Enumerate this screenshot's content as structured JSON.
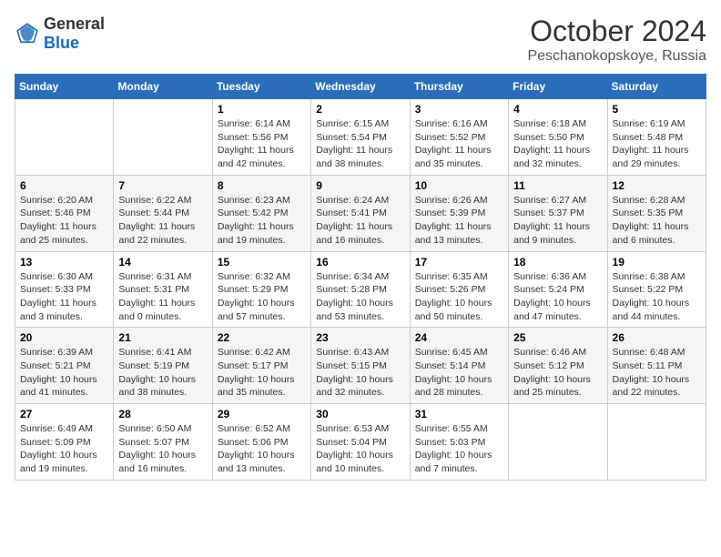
{
  "header": {
    "logo": {
      "text_general": "General",
      "text_blue": "Blue"
    },
    "title": "October 2024",
    "location": "Peschanokopskoye, Russia"
  },
  "weekdays": [
    "Sunday",
    "Monday",
    "Tuesday",
    "Wednesday",
    "Thursday",
    "Friday",
    "Saturday"
  ],
  "weeks": [
    [
      null,
      null,
      {
        "day": "1",
        "sunrise": "Sunrise: 6:14 AM",
        "sunset": "Sunset: 5:56 PM",
        "daylight": "Daylight: 11 hours and 42 minutes."
      },
      {
        "day": "2",
        "sunrise": "Sunrise: 6:15 AM",
        "sunset": "Sunset: 5:54 PM",
        "daylight": "Daylight: 11 hours and 38 minutes."
      },
      {
        "day": "3",
        "sunrise": "Sunrise: 6:16 AM",
        "sunset": "Sunset: 5:52 PM",
        "daylight": "Daylight: 11 hours and 35 minutes."
      },
      {
        "day": "4",
        "sunrise": "Sunrise: 6:18 AM",
        "sunset": "Sunset: 5:50 PM",
        "daylight": "Daylight: 11 hours and 32 minutes."
      },
      {
        "day": "5",
        "sunrise": "Sunrise: 6:19 AM",
        "sunset": "Sunset: 5:48 PM",
        "daylight": "Daylight: 11 hours and 29 minutes."
      }
    ],
    [
      {
        "day": "6",
        "sunrise": "Sunrise: 6:20 AM",
        "sunset": "Sunset: 5:46 PM",
        "daylight": "Daylight: 11 hours and 25 minutes."
      },
      {
        "day": "7",
        "sunrise": "Sunrise: 6:22 AM",
        "sunset": "Sunset: 5:44 PM",
        "daylight": "Daylight: 11 hours and 22 minutes."
      },
      {
        "day": "8",
        "sunrise": "Sunrise: 6:23 AM",
        "sunset": "Sunset: 5:42 PM",
        "daylight": "Daylight: 11 hours and 19 minutes."
      },
      {
        "day": "9",
        "sunrise": "Sunrise: 6:24 AM",
        "sunset": "Sunset: 5:41 PM",
        "daylight": "Daylight: 11 hours and 16 minutes."
      },
      {
        "day": "10",
        "sunrise": "Sunrise: 6:26 AM",
        "sunset": "Sunset: 5:39 PM",
        "daylight": "Daylight: 11 hours and 13 minutes."
      },
      {
        "day": "11",
        "sunrise": "Sunrise: 6:27 AM",
        "sunset": "Sunset: 5:37 PM",
        "daylight": "Daylight: 11 hours and 9 minutes."
      },
      {
        "day": "12",
        "sunrise": "Sunrise: 6:28 AM",
        "sunset": "Sunset: 5:35 PM",
        "daylight": "Daylight: 11 hours and 6 minutes."
      }
    ],
    [
      {
        "day": "13",
        "sunrise": "Sunrise: 6:30 AM",
        "sunset": "Sunset: 5:33 PM",
        "daylight": "Daylight: 11 hours and 3 minutes."
      },
      {
        "day": "14",
        "sunrise": "Sunrise: 6:31 AM",
        "sunset": "Sunset: 5:31 PM",
        "daylight": "Daylight: 11 hours and 0 minutes."
      },
      {
        "day": "15",
        "sunrise": "Sunrise: 6:32 AM",
        "sunset": "Sunset: 5:29 PM",
        "daylight": "Daylight: 10 hours and 57 minutes."
      },
      {
        "day": "16",
        "sunrise": "Sunrise: 6:34 AM",
        "sunset": "Sunset: 5:28 PM",
        "daylight": "Daylight: 10 hours and 53 minutes."
      },
      {
        "day": "17",
        "sunrise": "Sunrise: 6:35 AM",
        "sunset": "Sunset: 5:26 PM",
        "daylight": "Daylight: 10 hours and 50 minutes."
      },
      {
        "day": "18",
        "sunrise": "Sunrise: 6:36 AM",
        "sunset": "Sunset: 5:24 PM",
        "daylight": "Daylight: 10 hours and 47 minutes."
      },
      {
        "day": "19",
        "sunrise": "Sunrise: 6:38 AM",
        "sunset": "Sunset: 5:22 PM",
        "daylight": "Daylight: 10 hours and 44 minutes."
      }
    ],
    [
      {
        "day": "20",
        "sunrise": "Sunrise: 6:39 AM",
        "sunset": "Sunset: 5:21 PM",
        "daylight": "Daylight: 10 hours and 41 minutes."
      },
      {
        "day": "21",
        "sunrise": "Sunrise: 6:41 AM",
        "sunset": "Sunset: 5:19 PM",
        "daylight": "Daylight: 10 hours and 38 minutes."
      },
      {
        "day": "22",
        "sunrise": "Sunrise: 6:42 AM",
        "sunset": "Sunset: 5:17 PM",
        "daylight": "Daylight: 10 hours and 35 minutes."
      },
      {
        "day": "23",
        "sunrise": "Sunrise: 6:43 AM",
        "sunset": "Sunset: 5:15 PM",
        "daylight": "Daylight: 10 hours and 32 minutes."
      },
      {
        "day": "24",
        "sunrise": "Sunrise: 6:45 AM",
        "sunset": "Sunset: 5:14 PM",
        "daylight": "Daylight: 10 hours and 28 minutes."
      },
      {
        "day": "25",
        "sunrise": "Sunrise: 6:46 AM",
        "sunset": "Sunset: 5:12 PM",
        "daylight": "Daylight: 10 hours and 25 minutes."
      },
      {
        "day": "26",
        "sunrise": "Sunrise: 6:48 AM",
        "sunset": "Sunset: 5:11 PM",
        "daylight": "Daylight: 10 hours and 22 minutes."
      }
    ],
    [
      {
        "day": "27",
        "sunrise": "Sunrise: 6:49 AM",
        "sunset": "Sunset: 5:09 PM",
        "daylight": "Daylight: 10 hours and 19 minutes."
      },
      {
        "day": "28",
        "sunrise": "Sunrise: 6:50 AM",
        "sunset": "Sunset: 5:07 PM",
        "daylight": "Daylight: 10 hours and 16 minutes."
      },
      {
        "day": "29",
        "sunrise": "Sunrise: 6:52 AM",
        "sunset": "Sunset: 5:06 PM",
        "daylight": "Daylight: 10 hours and 13 minutes."
      },
      {
        "day": "30",
        "sunrise": "Sunrise: 6:53 AM",
        "sunset": "Sunset: 5:04 PM",
        "daylight": "Daylight: 10 hours and 10 minutes."
      },
      {
        "day": "31",
        "sunrise": "Sunrise: 6:55 AM",
        "sunset": "Sunset: 5:03 PM",
        "daylight": "Daylight: 10 hours and 7 minutes."
      },
      null,
      null
    ]
  ]
}
